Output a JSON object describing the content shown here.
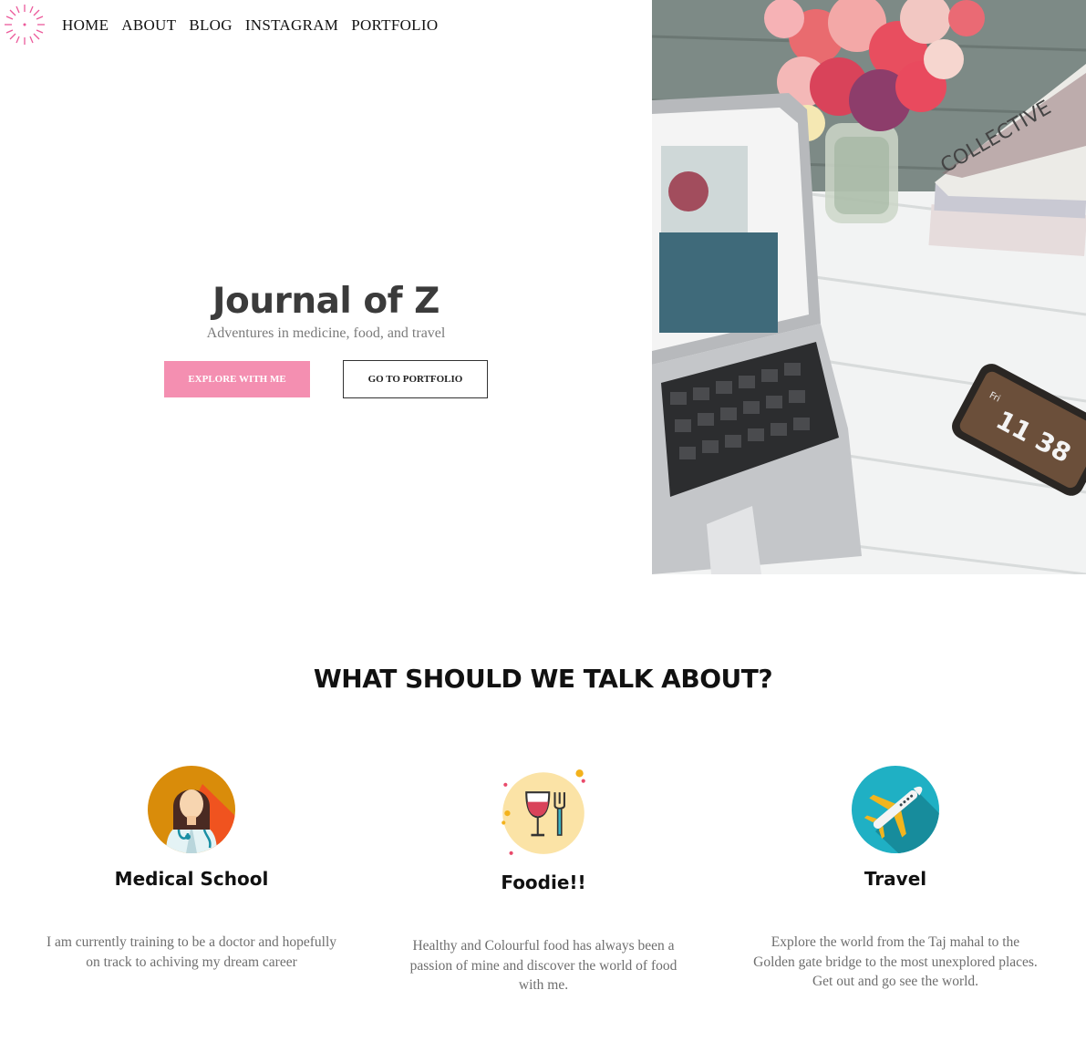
{
  "nav": {
    "logo_icon": "pink-starburst-logo-icon",
    "items": [
      "HOME",
      "ABOUT",
      "BLOG",
      "INSTAGRAM",
      "PORTFOLIO"
    ]
  },
  "hero": {
    "title": "Journal of Z",
    "subtitle": "Adventures in medicine, food, and travel",
    "primary_button": "EXPLORE WITH ME",
    "secondary_button": "GO TO PORTFOLIO",
    "photo_clock_day": "Fri",
    "photo_clock_time": "11 38",
    "photo_magazine_text": "COLLECTIVE"
  },
  "section": {
    "title": "WHAT SHOULD WE TALK ABOUT?",
    "cards": [
      {
        "icon": "doctor-icon",
        "title": "Medical School",
        "text": "I am currently training to be a doctor and hopefully on track to achiving my dream career"
      },
      {
        "icon": "wine-fork-icon",
        "title": "Foodie!!",
        "text": "Healthy and Colourful food has always been a passion of mine and discover the world of food with me."
      },
      {
        "icon": "airplane-icon",
        "title": "Travel",
        "text": "Explore the world from the Taj mahal to the Golden gate bridge to the most unexplored places. Get out and go see the world."
      }
    ]
  },
  "colors": {
    "accent_pink": "#f48fb1",
    "title_gray": "#3b3b3b",
    "doctor_bg": "#d98c0a",
    "food_bg": "#fbe3a6",
    "travel_bg": "#1fb0c4"
  }
}
